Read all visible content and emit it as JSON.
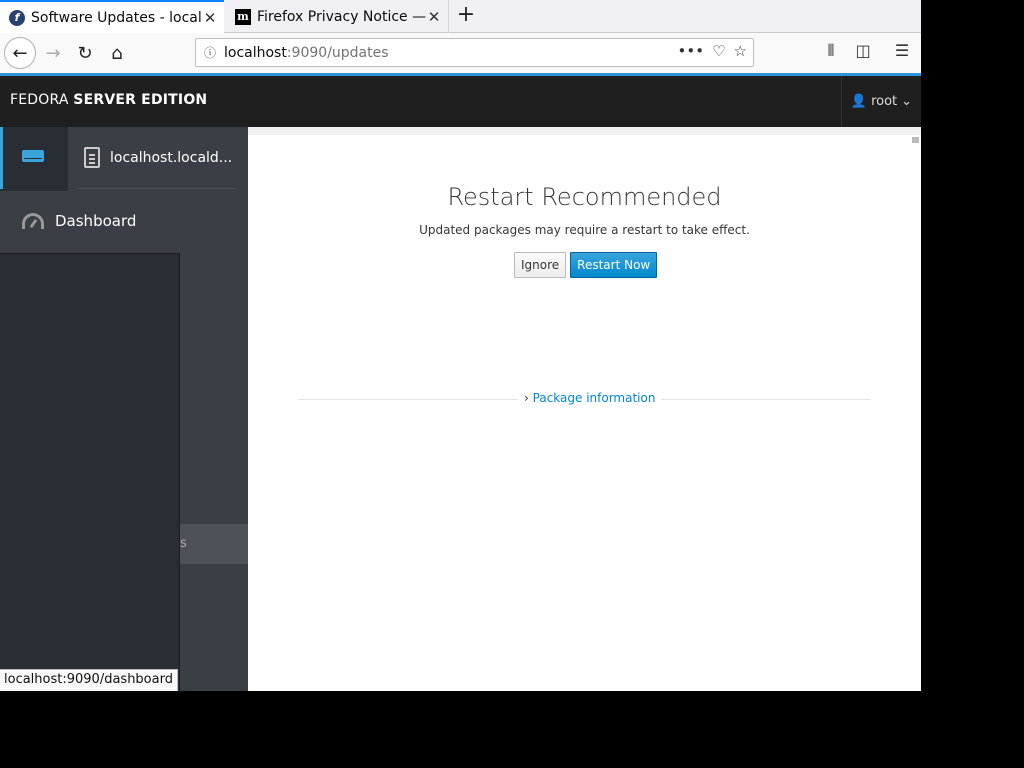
{
  "browser": {
    "tabs": [
      {
        "title": "Software Updates - localhost",
        "favicon": "fedora-icon",
        "active": true
      },
      {
        "title": "Firefox Privacy Notice — Mozilla",
        "favicon": "mozilla-icon",
        "active": false
      }
    ],
    "url": {
      "host": "localhost",
      "path": ":9090/updates"
    },
    "status_url": "localhost:9090/dashboard"
  },
  "header": {
    "brand_light": "FEDORA ",
    "brand_bold": "SERVER EDITION",
    "user": "root"
  },
  "nav": {
    "host": "localhost.locald...",
    "dashboard": "Dashboard",
    "hidden_item_fragment": "s"
  },
  "main": {
    "title": "Restart Recommended",
    "message": "Updated packages may require a restart to take effect.",
    "ignore_label": "Ignore",
    "restart_label": "Restart Now",
    "package_info_label": "Package information"
  },
  "colors": {
    "accent": "#39a5dc",
    "primary_button": "#0088ce",
    "header_bg": "#1f1f1f"
  }
}
